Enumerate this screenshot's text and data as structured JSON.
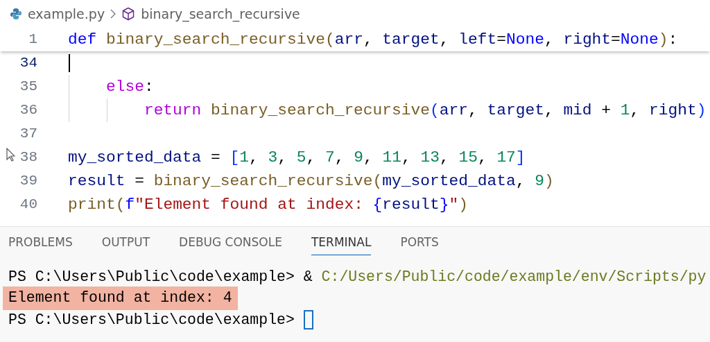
{
  "breadcrumb": {
    "file": "example.py",
    "symbol": "binary_search_recursive"
  },
  "sticky_line": {
    "number": "1",
    "tokens": [
      {
        "kind": "keyword2",
        "text": "def"
      },
      {
        "kind": "function",
        "text": " binary_search_recursive"
      },
      {
        "kind": "bracket1",
        "text": "("
      },
      {
        "kind": "variable",
        "text": "arr"
      },
      {
        "kind": "plain",
        "text": ", "
      },
      {
        "kind": "variable",
        "text": "target"
      },
      {
        "kind": "plain",
        "text": ", "
      },
      {
        "kind": "variable",
        "text": "left"
      },
      {
        "kind": "plain",
        "text": "="
      },
      {
        "kind": "constant",
        "text": "None"
      },
      {
        "kind": "plain",
        "text": ", "
      },
      {
        "kind": "variable",
        "text": "right"
      },
      {
        "kind": "plain",
        "text": "="
      },
      {
        "kind": "constant",
        "text": "None"
      },
      {
        "kind": "bracket1",
        "text": ")"
      },
      {
        "kind": "plain",
        "text": ":"
      }
    ]
  },
  "lines": [
    {
      "number": "34",
      "cursor": true
    },
    {
      "number": "35",
      "cursor": false,
      "tokens": [
        {
          "kind": "keyword",
          "text": "    else"
        },
        {
          "kind": "plain",
          "text": ":"
        }
      ]
    },
    {
      "number": "36",
      "cursor": false,
      "tokens": [
        {
          "kind": "keyword",
          "text": "        return"
        },
        {
          "kind": "function",
          "text": " binary_search_recursive"
        },
        {
          "kind": "bracket2",
          "text": "("
        },
        {
          "kind": "variable",
          "text": "arr"
        },
        {
          "kind": "plain",
          "text": ", "
        },
        {
          "kind": "variable",
          "text": "target"
        },
        {
          "kind": "plain",
          "text": ", "
        },
        {
          "kind": "variable",
          "text": "mid"
        },
        {
          "kind": "plain",
          "text": " + "
        },
        {
          "kind": "number",
          "text": "1"
        },
        {
          "kind": "plain",
          "text": ", "
        },
        {
          "kind": "variable",
          "text": "right"
        },
        {
          "kind": "bracket2",
          "text": ")"
        }
      ]
    },
    {
      "number": "37",
      "cursor": false
    },
    {
      "number": "38",
      "cursor": false,
      "tokens": [
        {
          "kind": "variable",
          "text": "my_sorted_data"
        },
        {
          "kind": "plain",
          "text": " = "
        },
        {
          "kind": "bracket2",
          "text": "["
        },
        {
          "kind": "number",
          "text": "1"
        },
        {
          "kind": "plain",
          "text": ", "
        },
        {
          "kind": "number",
          "text": "3"
        },
        {
          "kind": "plain",
          "text": ", "
        },
        {
          "kind": "number",
          "text": "5"
        },
        {
          "kind": "plain",
          "text": ", "
        },
        {
          "kind": "number",
          "text": "7"
        },
        {
          "kind": "plain",
          "text": ", "
        },
        {
          "kind": "number",
          "text": "9"
        },
        {
          "kind": "plain",
          "text": ", "
        },
        {
          "kind": "number",
          "text": "11"
        },
        {
          "kind": "plain",
          "text": ", "
        },
        {
          "kind": "number",
          "text": "13"
        },
        {
          "kind": "plain",
          "text": ", "
        },
        {
          "kind": "number",
          "text": "15"
        },
        {
          "kind": "plain",
          "text": ", "
        },
        {
          "kind": "number",
          "text": "17"
        },
        {
          "kind": "bracket2",
          "text": "]"
        }
      ]
    },
    {
      "number": "39",
      "cursor": false,
      "tokens": [
        {
          "kind": "variable",
          "text": "result"
        },
        {
          "kind": "plain",
          "text": " = "
        },
        {
          "kind": "function",
          "text": "binary_search_recursive"
        },
        {
          "kind": "bracket1",
          "text": "("
        },
        {
          "kind": "variable",
          "text": "my_sorted_data"
        },
        {
          "kind": "plain",
          "text": ", "
        },
        {
          "kind": "number",
          "text": "9"
        },
        {
          "kind": "bracket1",
          "text": ")"
        }
      ]
    },
    {
      "number": "40",
      "cursor": false,
      "tokens": [
        {
          "kind": "function",
          "text": "print"
        },
        {
          "kind": "bracket1",
          "text": "("
        },
        {
          "kind": "keyword2",
          "text": "f"
        },
        {
          "kind": "string",
          "text": "\"Element found at index: "
        },
        {
          "kind": "constant",
          "text": "{"
        },
        {
          "kind": "variable",
          "text": "result"
        },
        {
          "kind": "constant",
          "text": "}"
        },
        {
          "kind": "string",
          "text": "\""
        },
        {
          "kind": "bracket1",
          "text": ")"
        }
      ]
    }
  ],
  "panel_tabs": [
    {
      "label": "PROBLEMS",
      "selected": false
    },
    {
      "label": "OUTPUT",
      "selected": false
    },
    {
      "label": "DEBUG CONSOLE",
      "selected": false
    },
    {
      "label": "TERMINAL",
      "selected": true
    },
    {
      "label": "PORTS",
      "selected": false
    }
  ],
  "terminal": [
    {
      "highlighted": false,
      "cursor": false,
      "tokens": [
        {
          "kind": "plain",
          "text": "PS C:\\Users\\Public\\code\\example> & "
        },
        {
          "kind": "path",
          "text": "C:/Users/Public/code/example/env/Scripts/py"
        }
      ]
    },
    {
      "highlighted": true,
      "cursor": false,
      "tokens": [
        {
          "kind": "plain",
          "text": "Element found at index: 4"
        }
      ]
    },
    {
      "highlighted": false,
      "cursor": true,
      "tokens": [
        {
          "kind": "plain",
          "text": "PS C:\\Users\\Public\\code\\example> "
        }
      ]
    }
  ]
}
